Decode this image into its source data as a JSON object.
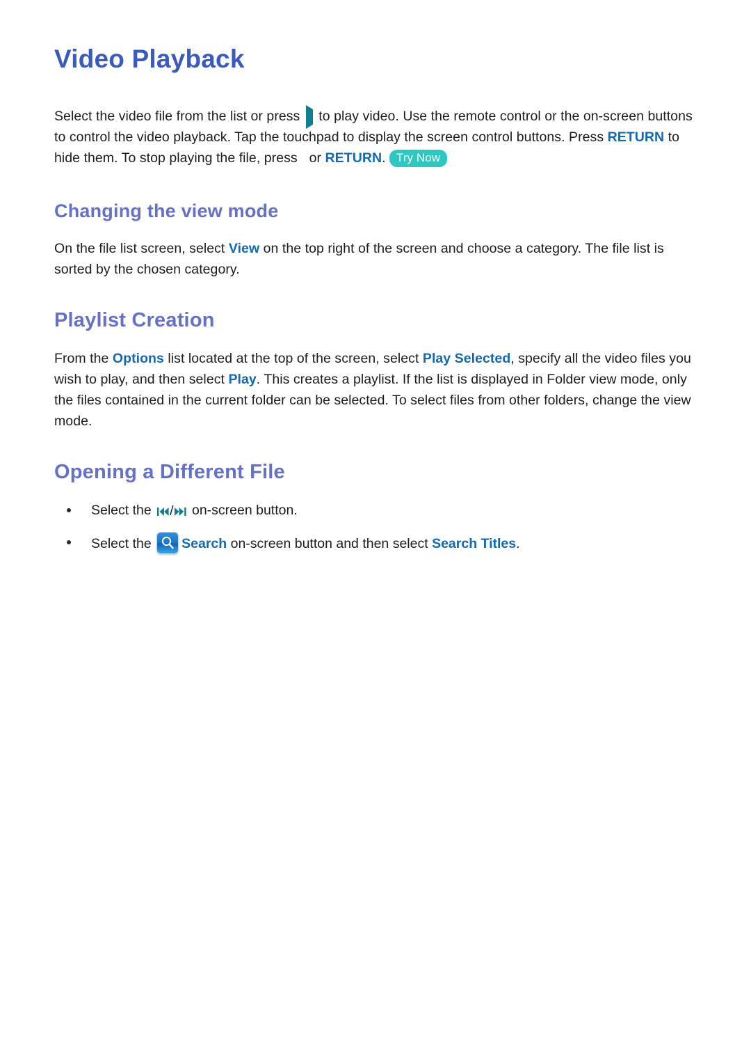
{
  "document": {
    "title": "Video Playback",
    "intro": {
      "part1": "Select the video file from the list or press ",
      "play_icon": "play-icon",
      "part2": " to play video. Use the remote control or the on-screen buttons to control the video playback. Tap the touchpad to display the screen control buttons. Press ",
      "return_kw_1": "RETURN",
      "part3": " to hide them. To stop playing the file, press ",
      "stop_icon": "stop-icon",
      "part4": " or ",
      "return_kw_2": "RETURN",
      "part5": ". ",
      "try_now_badge": "Try Now"
    },
    "sections": [
      {
        "heading": "Changing the view mode",
        "body": {
          "part1": "On the file list screen, select ",
          "kw1": "View",
          "part2": " on the top right of the screen and choose a category. The file list is sorted by the chosen category."
        }
      },
      {
        "heading": "Playlist Creation",
        "body": {
          "part1": "From the ",
          "kw1": "Options",
          "part2": " list located at the top of the screen, select ",
          "kw2": "Play Selected",
          "part3": ", specify all the video files you wish to play, and then select ",
          "kw3": "Play",
          "part4": ". This creates a playlist. If the list is displayed in Folder view mode, only the files contained in the current folder can be selected. To select files from other folders, change the view mode."
        }
      },
      {
        "heading": "Opening a Different File",
        "bullets": [
          {
            "part1": "Select the ",
            "icon_prev": "skip-backward-icon",
            "separator": "/",
            "icon_next": "skip-forward-icon",
            "part2": " on-screen button."
          },
          {
            "part1": "Select the ",
            "icon_search": "search-icon",
            "kw1": "Search",
            "part2": " on-screen button and then select ",
            "kw2": "Search Titles",
            "part3": "."
          }
        ]
      }
    ]
  },
  "colors": {
    "title_blue": "#3a5bbd",
    "heading_periwinkle": "#6571c6",
    "keyword_blue": "#1268b3",
    "try_now_teal": "#2ec7c2",
    "media_icon_teal": "#0f7d94",
    "search_button_blue": "#1f79c9",
    "body_text": "#1c1c1c",
    "page_background": "#ffffff"
  }
}
